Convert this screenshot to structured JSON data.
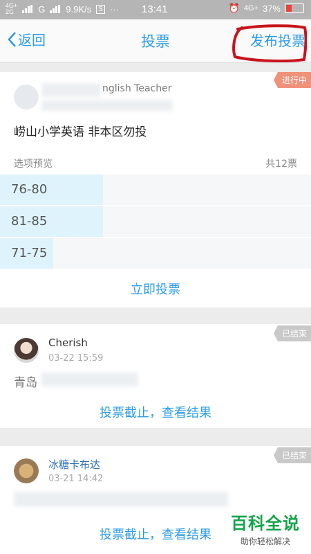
{
  "status_bar": {
    "network_top": "4G+",
    "network_bottom": "2G",
    "carrier": "G",
    "speed": "9.9K/s",
    "time": "13:41",
    "network_right": "4G+",
    "battery": "37%",
    "battery_level": 0.37
  },
  "nav": {
    "back_label": "返回",
    "title": "投票",
    "publish_label": "发布投票"
  },
  "polls": [
    {
      "status": "进行中",
      "author": "nglish Teacher",
      "title": "崂山小学英语 非本区勿投",
      "preview_label": "选项预览",
      "total_votes": "共12票",
      "options": [
        {
          "label": "76-80",
          "share": 0.33
        },
        {
          "label": "81-85",
          "share": 0.33
        },
        {
          "label": "71-75",
          "share": 0.17
        }
      ],
      "action": "立即投票"
    },
    {
      "status": "已结束",
      "author": "Cherish",
      "time": "03-22 15:59",
      "title": "青岛",
      "action": "投票截止，查看结果"
    },
    {
      "status": "已结束",
      "author": "冰糖卡布达",
      "time": "03-21 14:42",
      "title": "",
      "action": "投票截止，查看结果"
    }
  ],
  "watermark": {
    "main": "百科全说",
    "sub": "助你轻松解决"
  },
  "colors": {
    "accent": "#2a9be6",
    "active_badge": "#f0927a",
    "ended_badge": "#c9c9c9",
    "annotation": "#c8141c"
  }
}
